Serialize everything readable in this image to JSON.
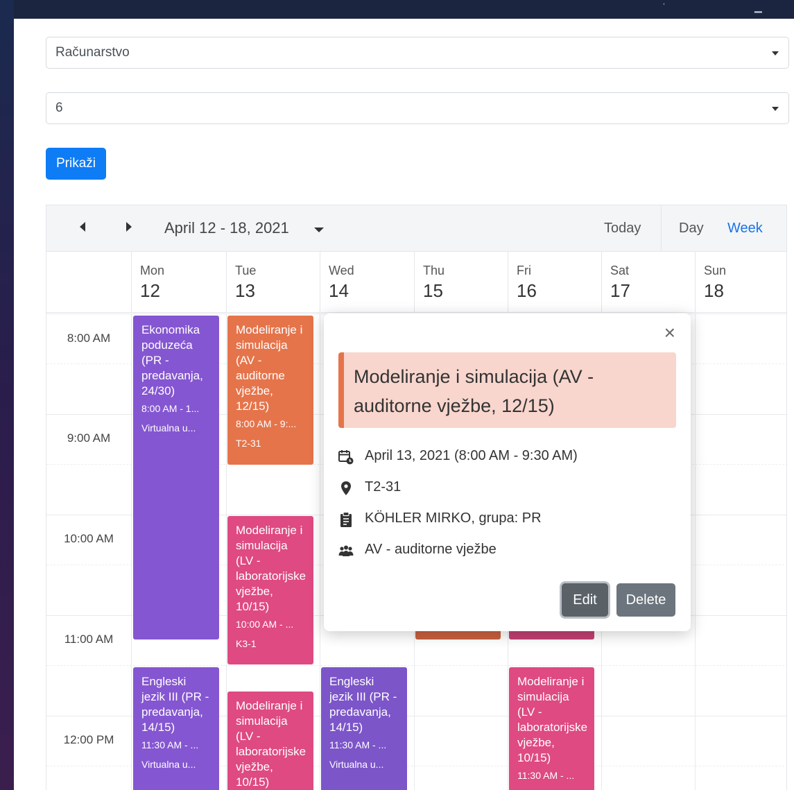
{
  "filters": {
    "department": "Računarstvo",
    "semester": "6",
    "show_button": "Prikaži"
  },
  "calendar": {
    "range": "April 12 - 18, 2021",
    "today": "Today",
    "view_day": "Day",
    "view_week": "Week",
    "days": [
      {
        "name": "Mon",
        "date": "12"
      },
      {
        "name": "Tue",
        "date": "13"
      },
      {
        "name": "Wed",
        "date": "14"
      },
      {
        "name": "Thu",
        "date": "15"
      },
      {
        "name": "Fri",
        "date": "16"
      },
      {
        "name": "Sat",
        "date": "17"
      },
      {
        "name": "Sun",
        "date": "18"
      }
    ],
    "times": [
      "8:00 AM",
      "9:00 AM",
      "10:00 AM",
      "11:00 AM",
      "12:00 PM"
    ],
    "events": [
      {
        "title": "Ekonomika poduzeća (PR - predavanja, 24/30)",
        "time": "8:00 AM - 1...",
        "place": "Virtualna u..."
      },
      {
        "title": "Modeliranje i simulacija (AV - auditorne vježbe, 12/15)",
        "time": "8:00 AM - 9:...",
        "place": "T2-31"
      },
      {
        "title": "Modeliranje i simulacija (LV - laboratorijske vježbe, 10/15)",
        "time": "10:00 AM - ...",
        "place": "K3-1"
      },
      {
        "title": "Engleski jezik III (PR - predavanja, 14/15)",
        "time": "11:30 AM - ...",
        "place": "Virtualna u..."
      },
      {
        "title": "Modeliranje i simulacija (LV - laboratorijske vježbe, 10/15)",
        "time": "",
        "place": ""
      },
      {
        "title": "Engleski jezik III (PR - predavanja, 14/15)",
        "time": "11:30 AM - ...",
        "place": "Virtualna u..."
      },
      {
        "title": "Modeliranje i simulacija (LV - laboratorijske vježbe, 10/15)",
        "time": "11:30 AM - ...",
        "place": ""
      }
    ],
    "colors": {
      "purple": "#8556d1",
      "orange": "#e5744b",
      "pink": "#de4a81",
      "accent": "#0d7cf5"
    }
  },
  "popup": {
    "title": "Modeliranje i simulacija (AV - auditorne vježbe, 12/15)",
    "date": "April 13, 2021 (8:00 AM - 9:30 AM)",
    "location": "T2-31",
    "teacher": "KÖHLER MIRKO, grupa: PR",
    "type": "AV - auditorne vježbe",
    "edit": "Edit",
    "delete": "Delete",
    "icons": [
      "calendar-clock-icon",
      "map-marker-icon",
      "clipboard-icon",
      "users-icon",
      "close-icon"
    ]
  }
}
